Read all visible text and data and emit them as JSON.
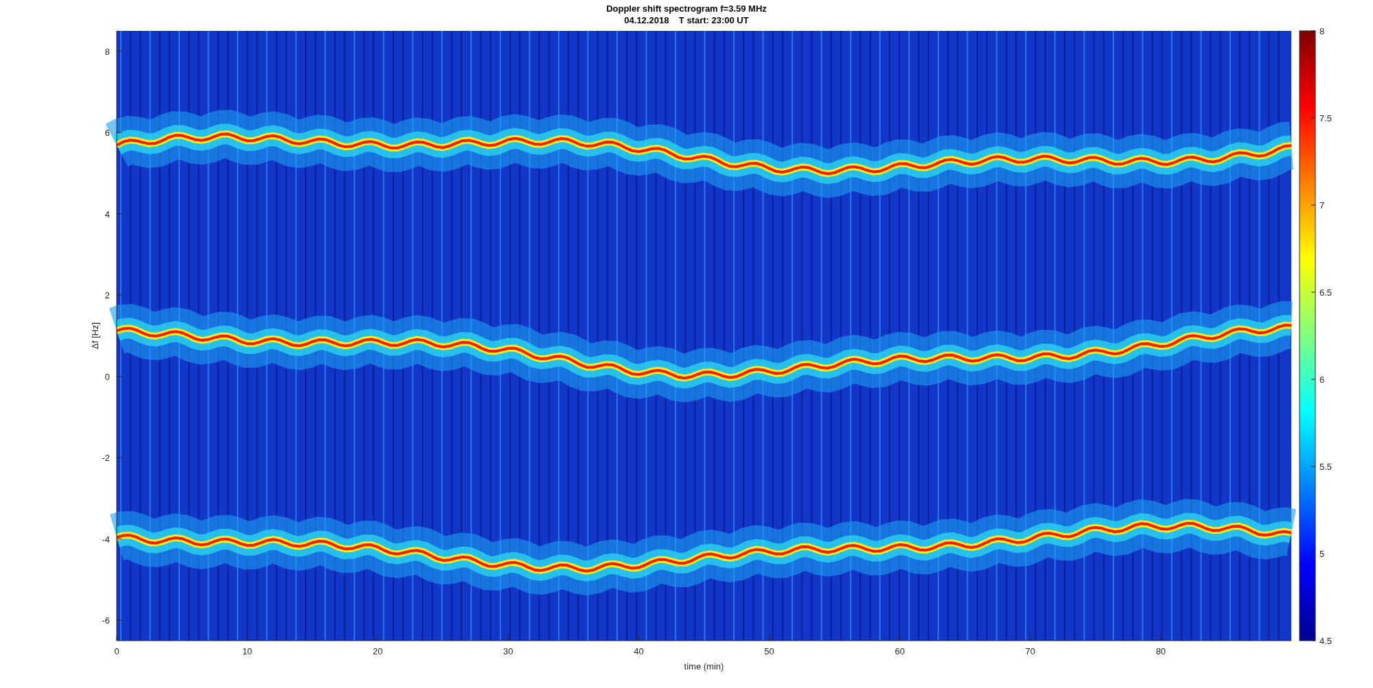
{
  "title": {
    "line_1": "Doppler shift spectrogram f=3.59 MHz",
    "line_2": "04.12.2018    T start: 23:00 UT"
  },
  "xlabel": "time (min)",
  "ylabel": "Δf [Hz]",
  "xticks": [
    "0",
    "10",
    "20",
    "30",
    "40",
    "50",
    "60",
    "70",
    "80"
  ],
  "yticks": [
    "8",
    "6",
    "4",
    "2",
    "0",
    "-2",
    "-4",
    "-6"
  ],
  "colorbar_ticks": [
    "8",
    "7.5",
    "7",
    "6.5",
    "6",
    "5.5",
    "5",
    "4.5"
  ]
}
